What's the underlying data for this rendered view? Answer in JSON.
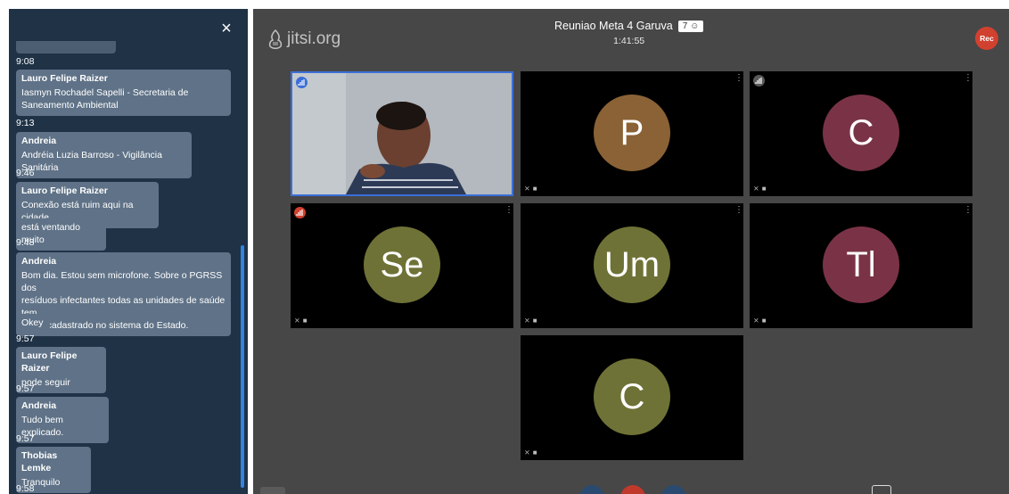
{
  "chat": {
    "close_label": "×",
    "messages": [
      {
        "time": "9:08"
      },
      {
        "sender": "Lauro Felipe Raizer",
        "lines": [
          "Iasmyn Rochadel Sapelli - Secretaria de",
          "Saneamento Ambiental"
        ],
        "time": "9:13"
      },
      {
        "sender": "Andreia",
        "lines": [
          "Andréia Luzia Barroso - Vigilância Sanitária"
        ],
        "time": "9:46"
      },
      {
        "sender": "Lauro Felipe Raizer",
        "lines": [
          "Conexão está ruim aqui na cidade"
        ]
      },
      {
        "lines": [
          "está ventando muito"
        ],
        "time": "9:48"
      },
      {
        "sender": "Andreia",
        "lines": [
          "Bom dia. Estou sem microfone. Sobre o PGRSS dos",
          "resíduos infectantes todas as unidades de saúde tem",
          "plano cadastrado no sistema do Estado."
        ]
      },
      {
        "lines": [
          "Okey"
        ],
        "time": "9:57"
      },
      {
        "sender": "Lauro Felipe Raizer",
        "lines": [
          "pode seguir"
        ],
        "time": "9:57"
      },
      {
        "sender": "Andreia",
        "lines": [
          "Tudo bem explicado."
        ],
        "time": "9:57"
      },
      {
        "sender": "Thobias Lemke",
        "lines": [
          "Tranquilo"
        ],
        "time": "9:58"
      }
    ]
  },
  "meeting": {
    "logo_text": "jitsi.org",
    "title": "Reuniao Meta 4 Garuva",
    "participant_count": "7",
    "duration": "1:41:55",
    "rec_label": "Rec"
  },
  "tiles": [
    {
      "initials": "",
      "color": "",
      "active": true
    },
    {
      "initials": "P",
      "color": "#8a6236"
    },
    {
      "initials": "C",
      "color": "#7a3346"
    },
    {
      "initials": "Se",
      "color": "#6f7236"
    },
    {
      "initials": "Um",
      "color": "#6f7236"
    },
    {
      "initials": "Tl",
      "color": "#7a3346"
    },
    {
      "initials": "C",
      "color": "#6f7236"
    }
  ],
  "icons": {
    "close": "close-icon",
    "participants": "participants-icon",
    "more": "more-options-icon",
    "mic_muted": "mic-muted-icon",
    "cam_muted": "camera-muted-icon",
    "connection": "connection-indicator-icon"
  }
}
